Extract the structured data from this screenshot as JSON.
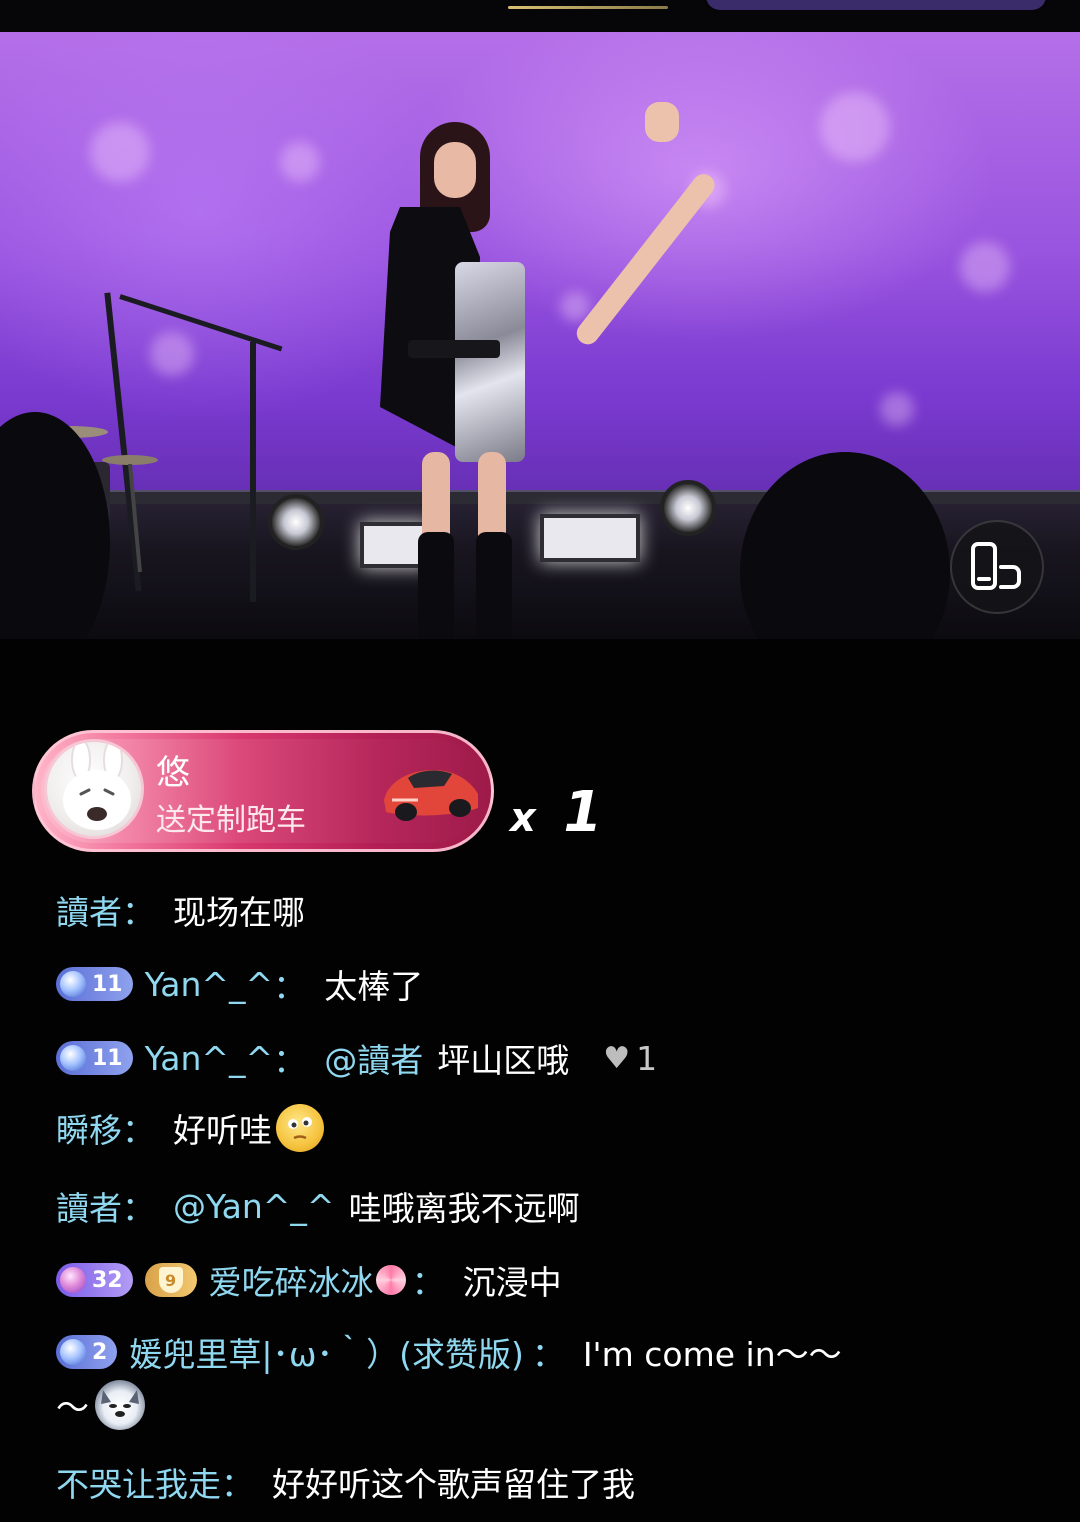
{
  "gift": {
    "user": "悠",
    "text": "送定制跑车",
    "multiplier": "x",
    "count": "1",
    "icon": "sports-car"
  },
  "controls": {
    "rotate_icon": "rotate-screen-icon"
  },
  "chat": {
    "messages": [
      {
        "user": "讀者",
        "colon": "：",
        "text": "现场在哪"
      },
      {
        "badge": "11",
        "user": "Yan^_^",
        "colon": "：",
        "text": "太棒了"
      },
      {
        "badge": "11",
        "user": "Yan^_^",
        "colon": "：",
        "mention": "@讀者",
        "text": "坪山区哦",
        "likes": "1"
      },
      {
        "user": "瞬移",
        "colon": "：",
        "text": "好听哇",
        "emoji": "thinking-face"
      },
      {
        "user": "讀者",
        "colon": "：",
        "mention": "@Yan^_^",
        "text": "哇哦离我不远啊"
      },
      {
        "badge": "32",
        "fan_badge": "9",
        "user": "爱吃碎冰冰",
        "colon": "：",
        "text": "沉浸中",
        "emoji": "lollipop"
      },
      {
        "badge": "2",
        "user": "媛兜里草|･ω･｀）(求赞版)",
        "colon": "：",
        "text": "I'm come in～～",
        "text2": "～",
        "emoji": "husky-dog"
      },
      {
        "user": "不哭让我走",
        "colon": "：",
        "text": "好好听这个歌声留住了我"
      }
    ]
  },
  "colors": {
    "username": "#8fd8f0",
    "gift_banner": "#d8386e",
    "badge_blue": "#5b6fd6",
    "badge_purple": "#7b5ce8",
    "badge_gold": "#d9a24a"
  }
}
